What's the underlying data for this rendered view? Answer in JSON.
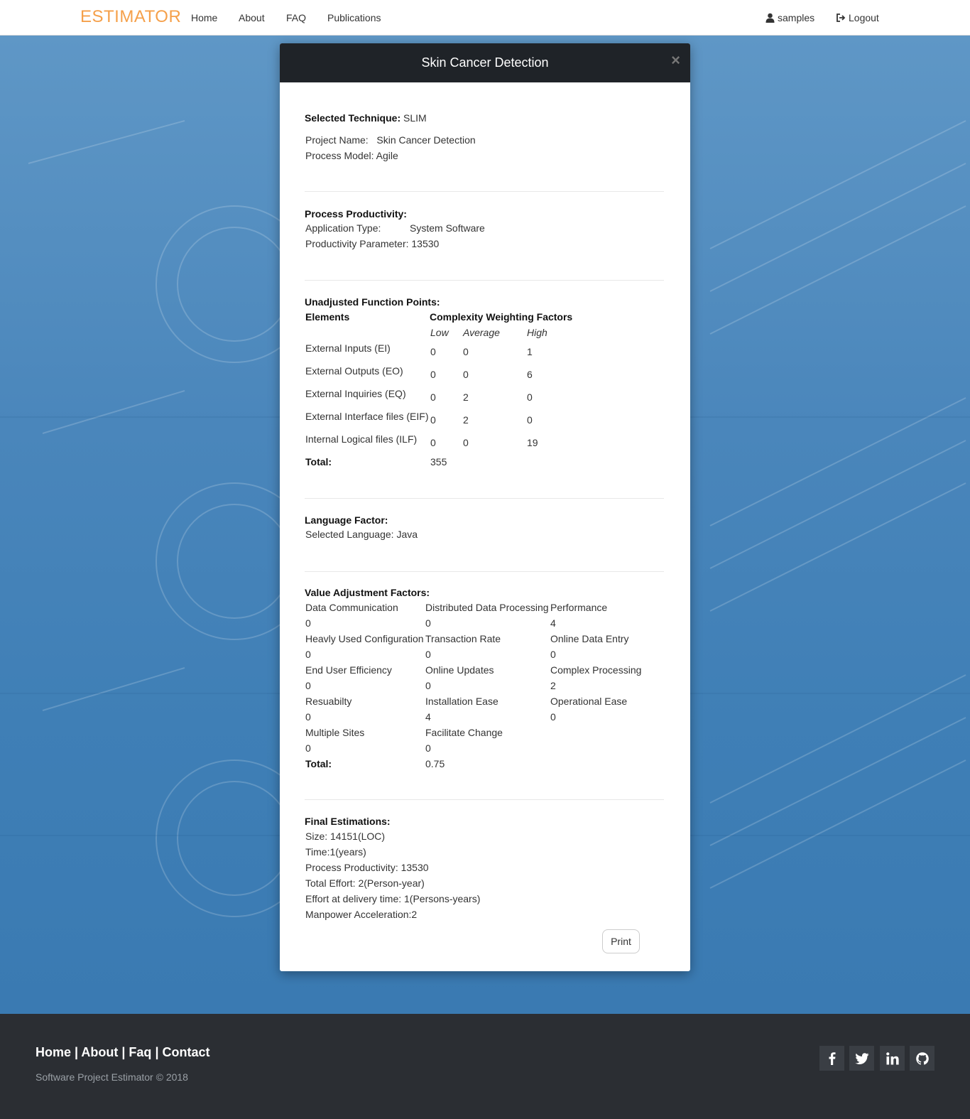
{
  "nav": {
    "brand": "ESTIMATOR",
    "items": [
      "Home",
      "About",
      "FAQ",
      "Publications"
    ],
    "user": "samples",
    "logout": "Logout"
  },
  "modal": {
    "title": "Skin Cancer Detection",
    "close": "×",
    "technique_label": "Selected Technique:",
    "technique_value": "SLIM",
    "project_name_label": "Project Name:",
    "project_name_value": "Skin Cancer Detection",
    "process_model_label": "Process Model:",
    "process_model_value": "Agile",
    "productivity": {
      "heading": "Process Productivity:",
      "app_type_label": "Application Type:",
      "app_type_value": "System Software",
      "param_label": "Productivity Parameter:",
      "param_value": "13530"
    },
    "ufp": {
      "heading": "Unadjusted Function Points:",
      "elements_header": "Elements",
      "cwf_header": "Complexity Weighting Factors",
      "low": "Low",
      "average": "Average",
      "high": "High",
      "rows": [
        {
          "name": "External Inputs (EI)",
          "low": "0",
          "average": "0",
          "high": "1"
        },
        {
          "name": "External Outputs (EO)",
          "low": "0",
          "average": "0",
          "high": "6"
        },
        {
          "name": "External Inquiries (EQ)",
          "low": "0",
          "average": "2",
          "high": "0"
        },
        {
          "name": "External Interface files (EIF)",
          "low": "0",
          "average": "2",
          "high": "0"
        },
        {
          "name": "Internal Logical files (ILF)",
          "low": "0",
          "average": "0",
          "high": "19"
        }
      ],
      "total_label": "Total:",
      "total_value": "355"
    },
    "language": {
      "heading": "Language Factor:",
      "selected_label": "Selected Language:",
      "selected_value": "Java"
    },
    "vaf": {
      "heading": "Value Adjustment Factors:",
      "items": [
        {
          "name": "Data Communication",
          "value": "0"
        },
        {
          "name": "Distributed Data Processing",
          "value": "0"
        },
        {
          "name": "Performance",
          "value": "4"
        },
        {
          "name": "Heavly Used Configuration",
          "value": "0"
        },
        {
          "name": "Transaction Rate",
          "value": "0"
        },
        {
          "name": "Online Data Entry",
          "value": "0"
        },
        {
          "name": "End User Efficiency",
          "value": "0"
        },
        {
          "name": "Online Updates",
          "value": "0"
        },
        {
          "name": "Complex Processing",
          "value": "2"
        },
        {
          "name": "Resuabilty",
          "value": "0"
        },
        {
          "name": "Installation Ease",
          "value": "4"
        },
        {
          "name": "Operational Ease",
          "value": "0"
        },
        {
          "name": "Multiple Sites",
          "value": "0"
        },
        {
          "name": "Facilitate Change",
          "value": "0"
        }
      ],
      "total_label": "Total:",
      "total_value": "0.75"
    },
    "final": {
      "heading": "Final Estimations:",
      "lines": [
        "Size: 14151(LOC)",
        "Time:1(years)",
        "Process Productivity: 13530",
        "Total Effort: 2(Person-year)",
        "Effort at delivery time: 1(Persons-years)",
        "Manpower Acceleration:2"
      ]
    },
    "print": "Print"
  },
  "footer": {
    "links": [
      "Home",
      "About",
      "Faq",
      "Contact"
    ],
    "separator": " | ",
    "copyright": "Software Project Estimator © 2018",
    "social": [
      "facebook-icon",
      "twitter-icon",
      "linkedin-icon",
      "github-icon"
    ]
  }
}
